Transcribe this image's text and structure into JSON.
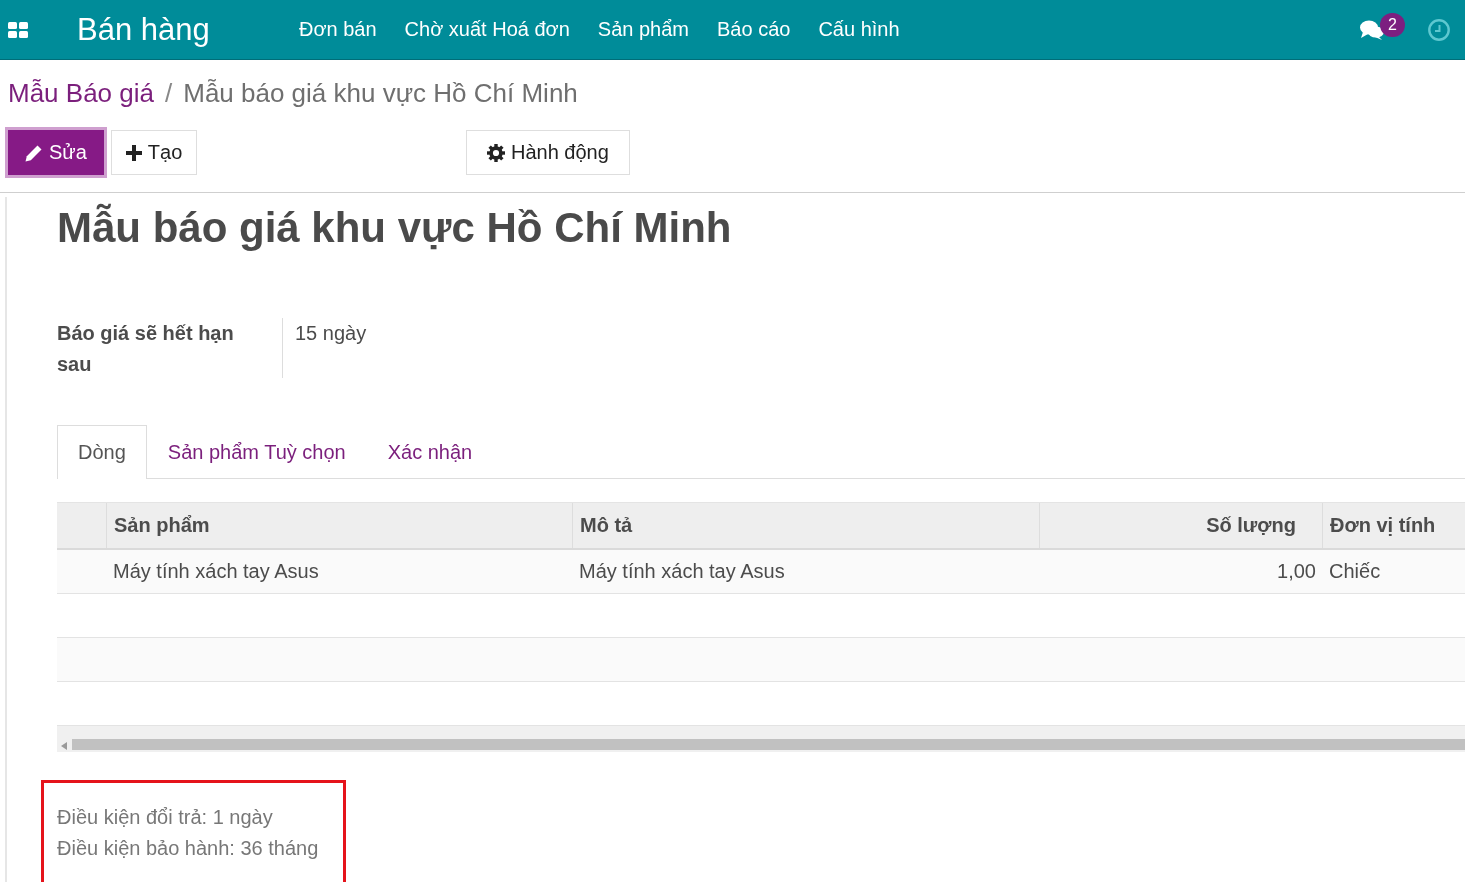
{
  "navbar": {
    "app_title": "Bán hàng",
    "menu": [
      "Đơn bán",
      "Chờ xuất Hoá đơn",
      "Sản phẩm",
      "Báo cáo",
      "Cấu hình"
    ],
    "messages_badge": "2"
  },
  "breadcrumb": {
    "parent": "Mẫu Báo giá",
    "separator": "/",
    "current": "Mẫu báo giá khu vực Hồ Chí Minh"
  },
  "buttons": [
    {
      "label": "Sửa",
      "kind": "edit",
      "focused": true
    },
    {
      "label": "Tạo",
      "kind": "create",
      "focused": false
    }
  ],
  "action_menu": {
    "label": "Hành động"
  },
  "form": {
    "title": "Mẫu báo giá khu vực Hồ Chí Minh",
    "fields": [
      {
        "label": "Báo giá sẽ hết hạn sau",
        "value": "15 ngày"
      }
    ],
    "tabs": [
      {
        "label": "Dòng",
        "selected": true
      },
      {
        "label": "Sản phẩm Tuỳ chọn",
        "selected": false
      },
      {
        "label": "Xác nhận",
        "selected": false
      }
    ],
    "table": {
      "columns": [
        {
          "label": "Sản phẩm",
          "kind": "text"
        },
        {
          "label": "Mô tả",
          "kind": "text"
        },
        {
          "label": "Số lượng",
          "kind": "number"
        },
        {
          "label": "Đơn vị tính",
          "kind": "text"
        }
      ],
      "rows": [
        {
          "cells": [
            "Máy tính xách tay Asus",
            "Máy tính xách tay Asus",
            "1,00",
            "Chiếc"
          ]
        }
      ]
    }
  },
  "note": {
    "highlighted": true,
    "lines": [
      "Điều kiện đổi trả: 1 ngày",
      "Điều kiện bảo hành: 36 tháng"
    ]
  }
}
